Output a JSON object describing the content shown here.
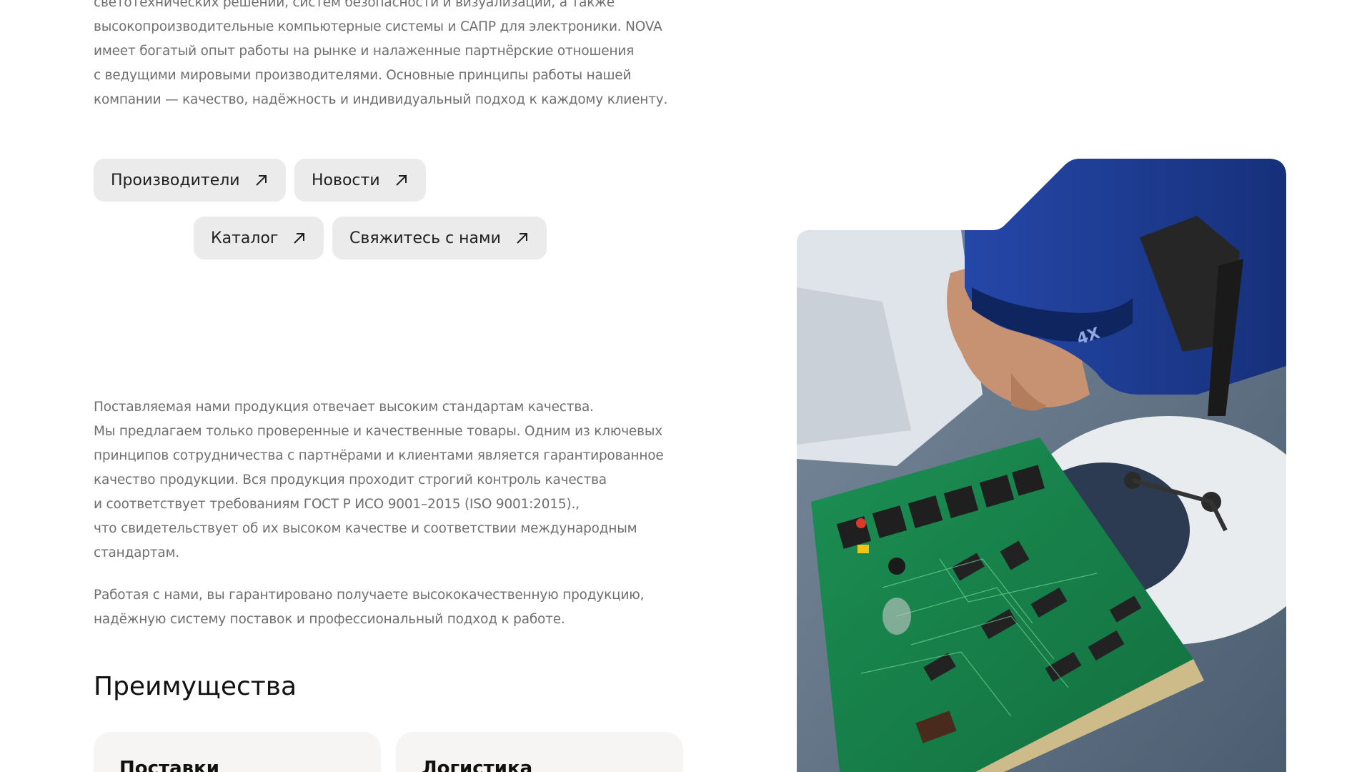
{
  "intro": {
    "lines": [
      "светотехнических решений, систем безопасности и визуализации, а также",
      "высокопроизводительные компьютерные системы и САПР для электроники. NOVA",
      "имеет богатый опыт работы на рынке и налаженные партнёрские отношения",
      "с ведущими мировыми производителями. Основные принципы работы нашей",
      "компании — качество, надёжность и индивидуальный подход к каждому клиенту."
    ]
  },
  "links": [
    {
      "label": "Производители",
      "icon": "arrow-up-right-icon"
    },
    {
      "label": "Новости",
      "icon": "arrow-up-right-icon"
    },
    {
      "label": "Каталог",
      "icon": "arrow-up-right-icon"
    },
    {
      "label": "Свяжитесь с нами",
      "icon": "arrow-up-right-icon"
    }
  ],
  "quality": {
    "lines": [
      "Поставляемая нами продукция отвечает высоким стандартам качества.",
      "Мы предлагаем только проверенные и качественные товары. Одним из ключевых",
      "принципов сотрудничества с партнёрами и клиентами является гарантированное",
      "качество продукции. Вся продукция проходит строгий контроль качества",
      "и соответствует требованиям ГОСТ Р ИСО 9001–2015 (ISO 9001:2015).,",
      "что свидетельствует об их высоком качестве и соответствии международным",
      "стандартам."
    ]
  },
  "guarantee": {
    "lines": [
      "Работая с нами, вы гарантировано получаете высококачественную продукцию,",
      "надёжную систему поставок и профессиональный подход к работе."
    ]
  },
  "advantages": {
    "title": "Преимущества",
    "cards": [
      {
        "title": "Поставки"
      },
      {
        "title": "Логистика"
      }
    ]
  },
  "photo": {
    "microscope_label": "4X",
    "colors": {
      "board": "#1e9a5a",
      "microscope": "#1f3f9a",
      "background": "#5f7286"
    }
  }
}
